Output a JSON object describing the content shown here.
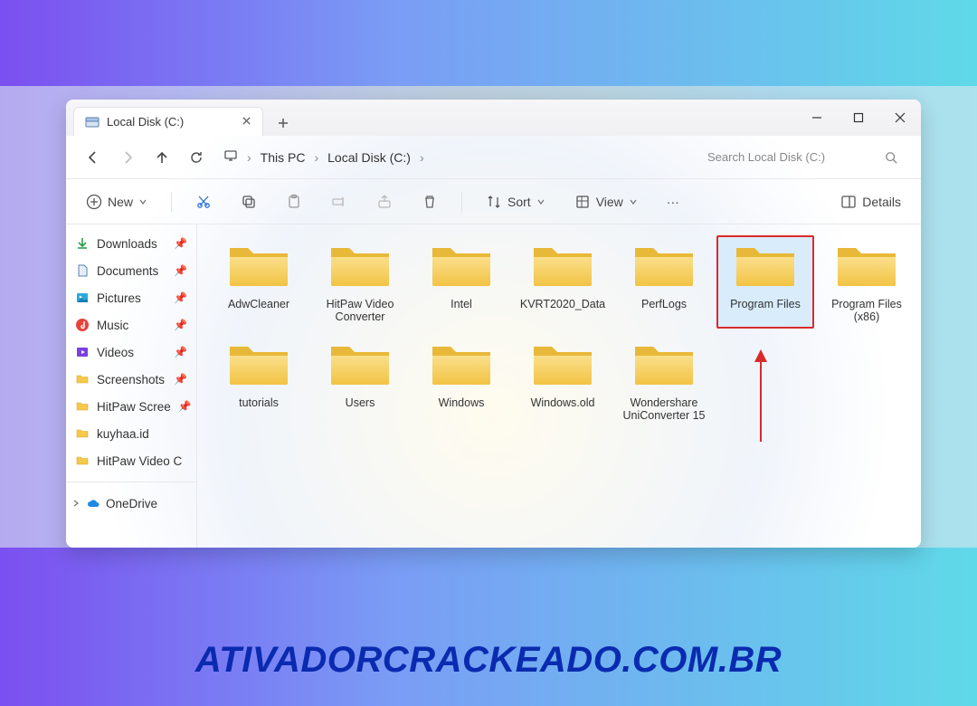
{
  "tab": {
    "title": "Local Disk (C:)"
  },
  "breadcrumbs": {
    "pc": "This PC",
    "disk": "Local Disk (C:)"
  },
  "search": {
    "placeholder": "Search Local Disk (C:)"
  },
  "toolbar": {
    "new_label": "New",
    "sort_label": "Sort",
    "view_label": "View",
    "details_label": "Details"
  },
  "sidebar": {
    "items": [
      {
        "label": "Downloads",
        "icon": "download",
        "pinned": true
      },
      {
        "label": "Documents",
        "icon": "document",
        "pinned": true
      },
      {
        "label": "Pictures",
        "icon": "pictures",
        "pinned": true
      },
      {
        "label": "Music",
        "icon": "music",
        "pinned": true
      },
      {
        "label": "Videos",
        "icon": "videos",
        "pinned": true
      },
      {
        "label": "Screenshots",
        "icon": "folder",
        "pinned": true
      },
      {
        "label": "HitPaw Scree",
        "icon": "folder",
        "pinned": true
      },
      {
        "label": "kuyhaa.id",
        "icon": "folder",
        "pinned": false
      },
      {
        "label": "HitPaw Video C",
        "icon": "folder",
        "pinned": false
      }
    ],
    "onedrive": "OneDrive"
  },
  "folders": [
    {
      "name": "AdwCleaner"
    },
    {
      "name": "HitPaw Video Converter"
    },
    {
      "name": "Intel"
    },
    {
      "name": "KVRT2020_Data"
    },
    {
      "name": "PerfLogs"
    },
    {
      "name": "Program Files",
      "highlight": true
    },
    {
      "name": "Program Files (x86)"
    },
    {
      "name": "tutorials"
    },
    {
      "name": "Users"
    },
    {
      "name": "Windows"
    },
    {
      "name": "Windows.old"
    },
    {
      "name": "Wondershare UniConverter 15"
    }
  ],
  "watermark": "ATIVADORCRACKEADO.COM.BR"
}
